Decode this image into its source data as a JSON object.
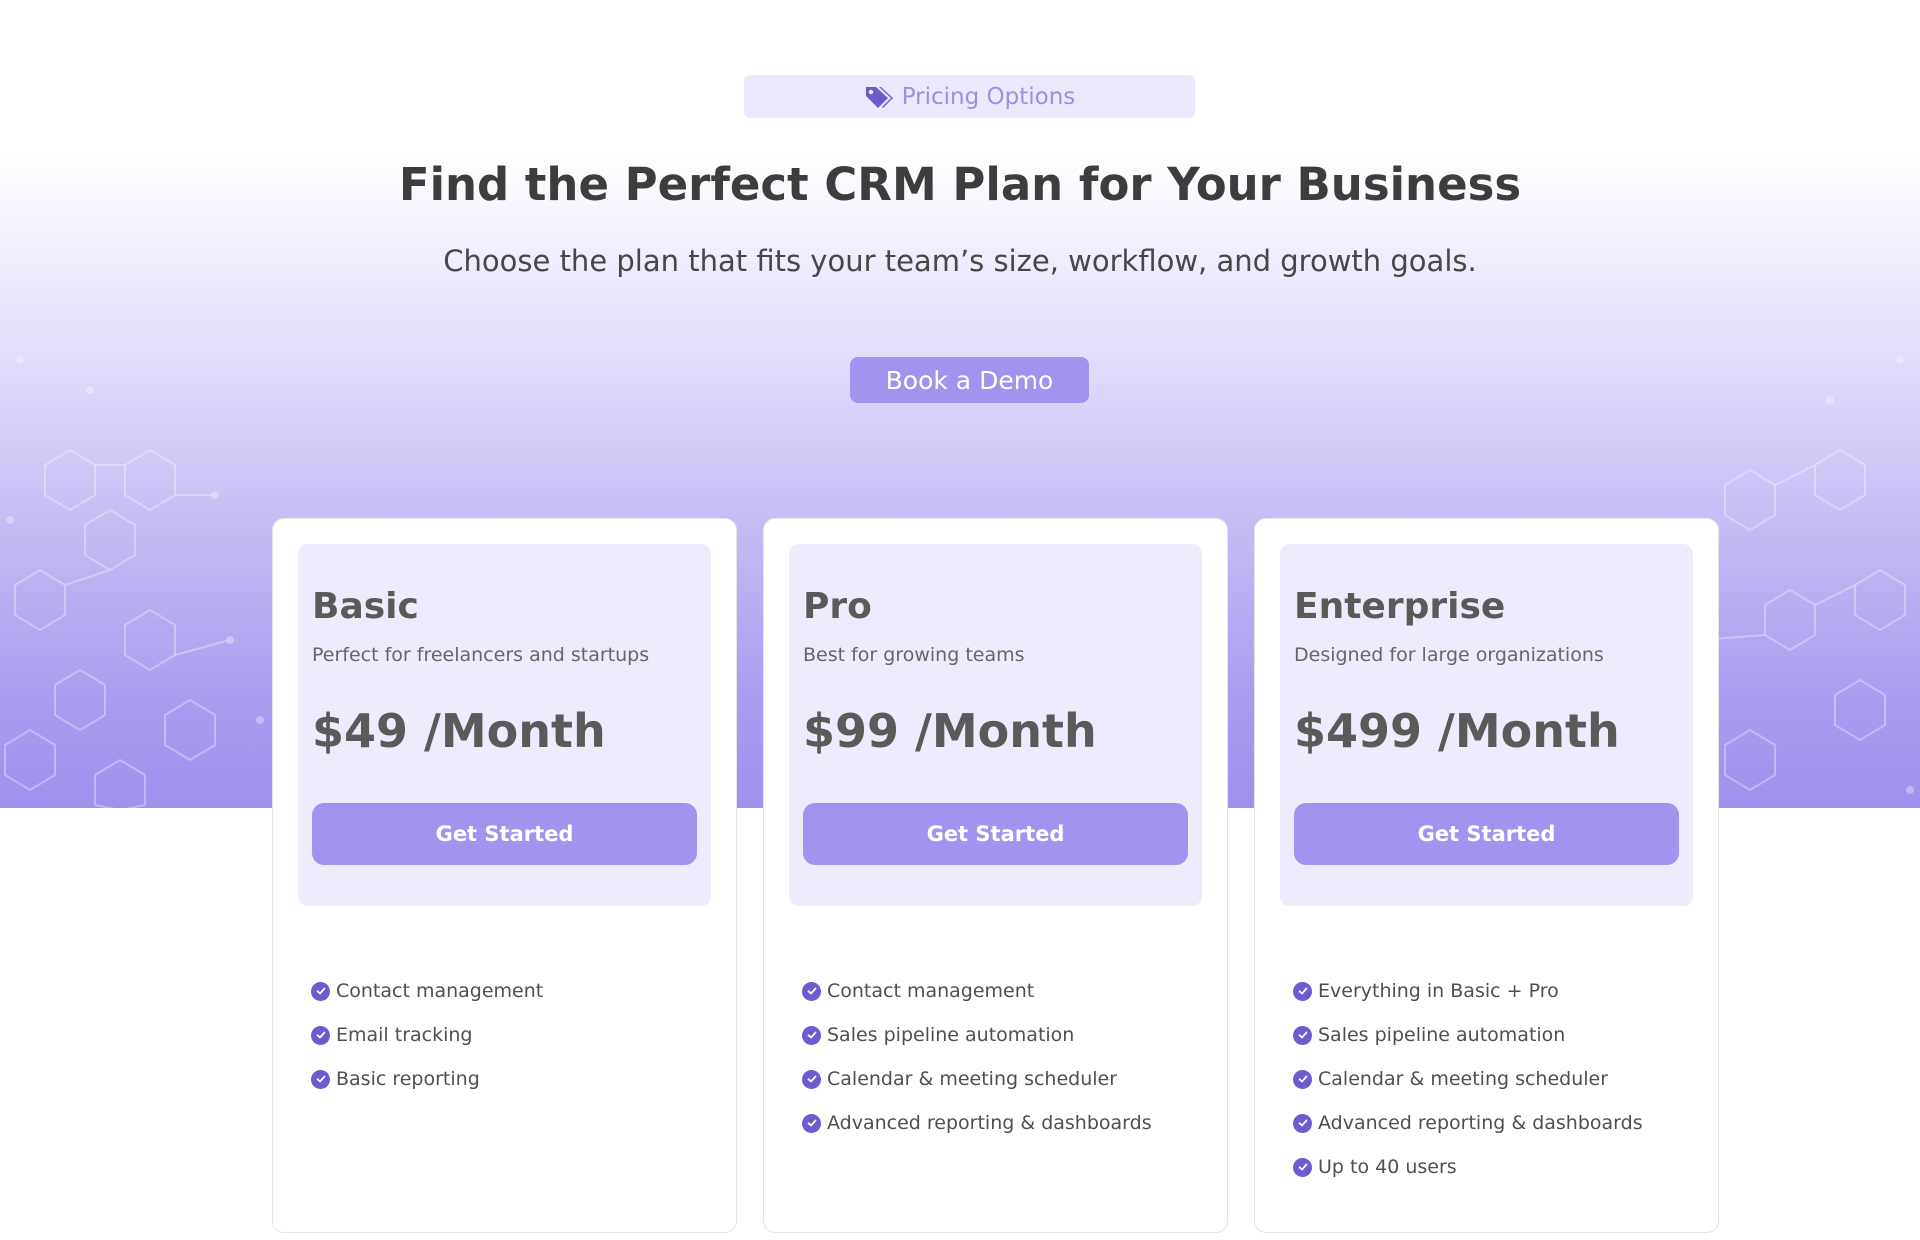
{
  "header": {
    "badge_label": "Pricing Options",
    "badge_icon": "tag-icon",
    "title": "Find the Perfect CRM Plan for Your Business",
    "subtitle": "Choose the plan that fits your team’s size, workflow, and growth goals.",
    "demo_button": "Book a Demo"
  },
  "colors": {
    "accent": "#a194ef",
    "check": "#6d5ccf",
    "card_head_bg": "#eeebfc"
  },
  "plans": [
    {
      "name": "Basic",
      "description": "Perfect for freelancers and startups",
      "price": "$49 /Month",
      "cta": "Get Started",
      "features": [
        "Contact management",
        "Email tracking",
        "Basic reporting"
      ]
    },
    {
      "name": "Pro",
      "description": "Best for growing teams",
      "price": "$99 /Month",
      "cta": "Get Started",
      "features": [
        "Contact management",
        "Sales pipeline automation",
        "Calendar & meeting scheduler",
        "Advanced reporting & dashboards"
      ]
    },
    {
      "name": "Enterprise",
      "description": "Designed for large organizations",
      "price": "$499 /Month",
      "cta": "Get Started",
      "features": [
        "Everything in Basic + Pro",
        "Sales pipeline automation",
        "Calendar & meeting scheduler",
        "Advanced reporting & dashboards",
        "Up to 40 users"
      ]
    }
  ]
}
